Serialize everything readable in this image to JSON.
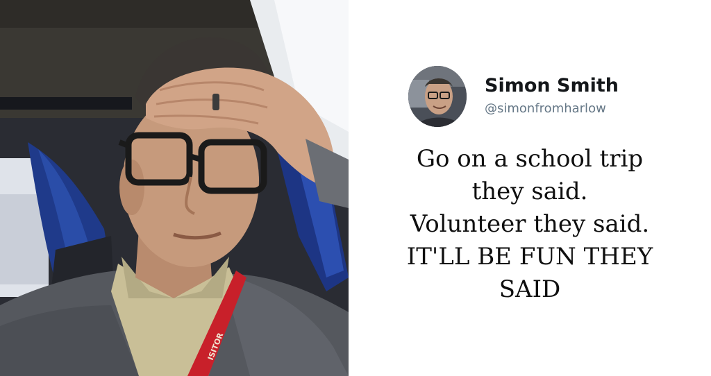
{
  "tweet": {
    "display_name": "Simon Smith",
    "handle": "@simonfromharlow",
    "lines": [
      "Go on a school trip",
      "they said.",
      "Volunteer they said.",
      "IT'LL BE FUN THEY",
      "SAID"
    ]
  },
  "photo": {
    "subject": "selfie-man-hand-on-forehead",
    "lanyard_text": "ISITOR"
  },
  "colors": {
    "name": "#14171a",
    "handle": "#657786",
    "text": "#0f0f0f",
    "lanyard": "#c8202a",
    "jacket": "#55585e",
    "shirt": "#c9bf97",
    "curtain": "#1f3a8a"
  }
}
